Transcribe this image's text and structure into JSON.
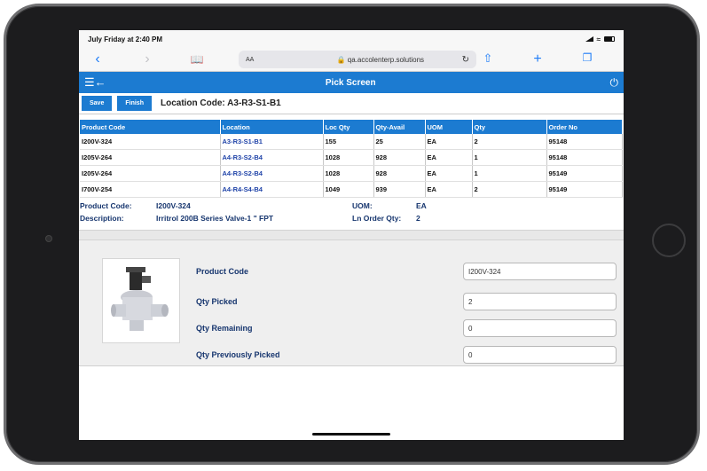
{
  "status": {
    "time": "July Friday at 2:40 PM"
  },
  "browser": {
    "text_size": "AA",
    "url": "qa.accolenterp.solutions"
  },
  "app": {
    "title": "Pick Screen"
  },
  "toolbar": {
    "save_label": "Save",
    "finish_label": "Finish",
    "location_label": "Location Code: A3-R3-S1-B1"
  },
  "table": {
    "headers": [
      "Product Code",
      "Location",
      "Loc Qty",
      "Qty-Avail",
      "UOM",
      "Qty",
      "Order No"
    ],
    "rows": [
      [
        "I200V-324",
        "A3-R3-S1-B1",
        "155",
        "25",
        "EA",
        "2",
        "95148"
      ],
      [
        "I205V-264",
        "A4-R3-S2-B4",
        "1028",
        "928",
        "EA",
        "1",
        "95148"
      ],
      [
        "I205V-264",
        "A4-R3-S2-B4",
        "1028",
        "928",
        "EA",
        "1",
        "95149"
      ],
      [
        "I700V-254",
        "A4-R4-S4-B4",
        "1049",
        "939",
        "EA",
        "2",
        "95149"
      ]
    ]
  },
  "info": {
    "product_code_label": "Product Code:",
    "product_code_value": "I200V-324",
    "uom_label": "UOM:",
    "uom_value": "EA",
    "description_label": "Description:",
    "description_value": "Irritrol 200B Series Valve-1 \" FPT",
    "ln_order_qty_label": "Ln Order Qty:",
    "ln_order_qty_value": "2"
  },
  "detail": {
    "product_code_label": "Product Code",
    "product_code_value": "I200V-324",
    "qty_picked_label": "Qty Picked",
    "qty_picked_value": "2",
    "qty_remaining_label": "Qty Remaining",
    "qty_remaining_value": "0",
    "qty_prev_label": "Qty Previously Picked",
    "qty_prev_value": "0"
  }
}
